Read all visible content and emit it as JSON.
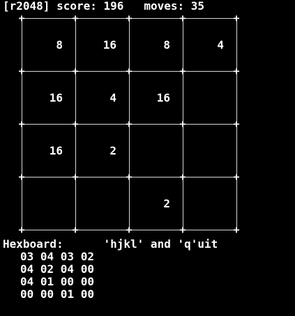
{
  "status": {
    "game": "[r2048]",
    "score_label": "score:",
    "score": "196",
    "moves_label": "moves:",
    "moves": "35"
  },
  "board": [
    [
      "8",
      "16",
      "8",
      "4"
    ],
    [
      "16",
      "4",
      "16",
      ""
    ],
    [
      "16",
      "2",
      "",
      ""
    ],
    [
      "",
      "",
      "2",
      ""
    ]
  ],
  "footer": {
    "hex_label": "Hexboard:",
    "help": "'hjkl' and 'q'uit"
  },
  "hexboard": [
    "03 04 03 02",
    "04 02 04 00",
    "04 01 00 00",
    "00 00 01 00"
  ],
  "colors": {
    "background": "#000000",
    "text": "#ffffff"
  }
}
